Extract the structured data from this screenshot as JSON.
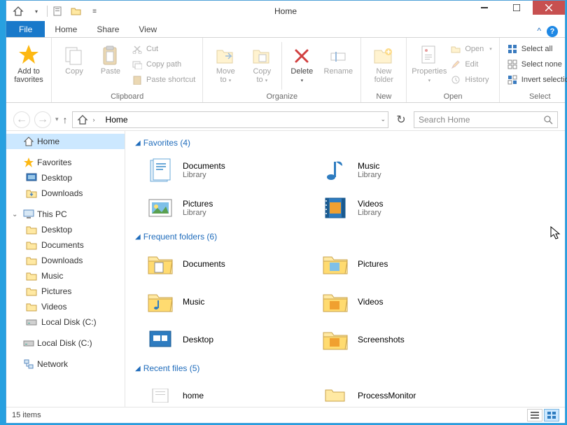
{
  "titlebar": {
    "title": "Home"
  },
  "tabs": {
    "file": "File",
    "home": "Home",
    "share": "Share",
    "view": "View"
  },
  "ribbon": {
    "add_to_fav": "Add to\nfavorites",
    "copy": "Copy",
    "paste": "Paste",
    "cut": "Cut",
    "copy_path": "Copy path",
    "paste_shortcut": "Paste shortcut",
    "clipboard": "Clipboard",
    "move_to": "Move\nto",
    "copy_to": "Copy\nto",
    "delete": "Delete",
    "rename": "Rename",
    "organize": "Organize",
    "new_folder": "New\nfolder",
    "new": "New",
    "properties": "Properties",
    "open": "Open",
    "edit": "Edit",
    "history": "History",
    "open_grp": "Open",
    "select_all": "Select all",
    "select_none": "Select none",
    "invert": "Invert selection",
    "select": "Select"
  },
  "nav": {
    "home": "Home",
    "search_placeholder": "Search Home"
  },
  "tree": {
    "home": "Home",
    "favorites": "Favorites",
    "desktop": "Desktop",
    "downloads": "Downloads",
    "this_pc": "This PC",
    "documents": "Documents",
    "music": "Music",
    "pictures": "Pictures",
    "videos": "Videos",
    "local_disk": "Local Disk (C:)",
    "network": "Network"
  },
  "sections": {
    "favorites": "Favorites (4)",
    "frequent": "Frequent folders (6)",
    "recent": "Recent files (5)"
  },
  "favorites": [
    {
      "name": "Documents",
      "sub": "Library"
    },
    {
      "name": "Music",
      "sub": "Library"
    },
    {
      "name": "Pictures",
      "sub": "Library"
    },
    {
      "name": "Videos",
      "sub": "Library"
    }
  ],
  "frequent": [
    {
      "name": "Documents"
    },
    {
      "name": "Pictures"
    },
    {
      "name": "Music"
    },
    {
      "name": "Videos"
    },
    {
      "name": "Desktop"
    },
    {
      "name": "Screenshots"
    }
  ],
  "recent": [
    {
      "name": "home"
    },
    {
      "name": "ProcessMonitor"
    }
  ],
  "status": {
    "count": "15 items"
  }
}
